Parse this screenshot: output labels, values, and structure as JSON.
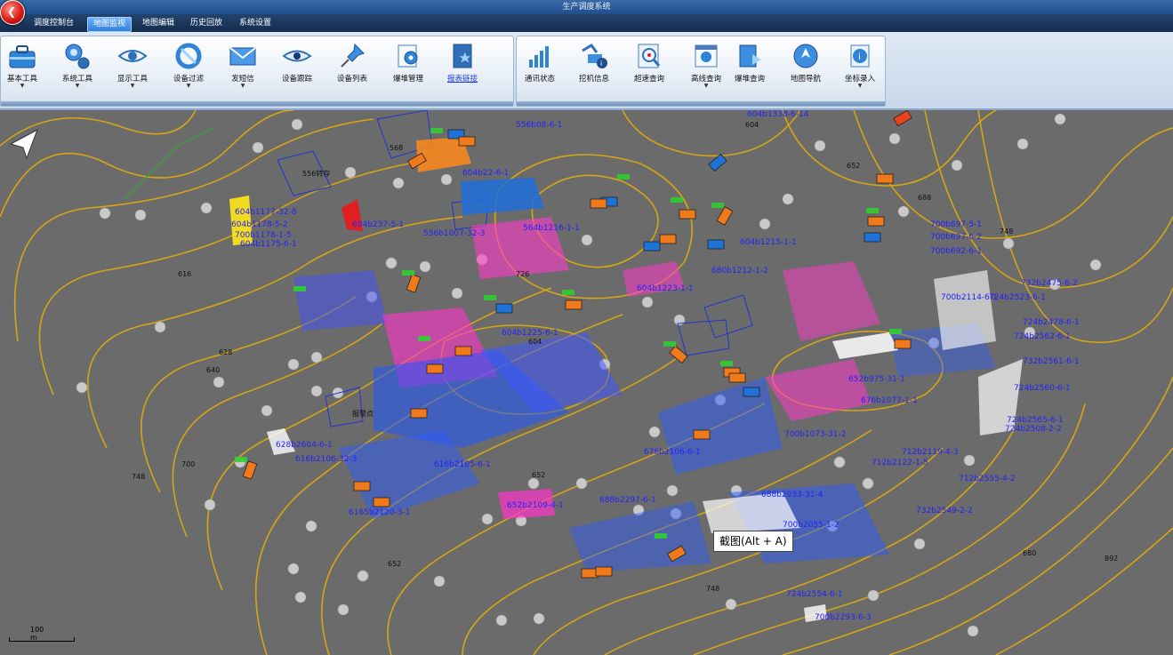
{
  "window": {
    "title": "生产调度系统"
  },
  "menu": {
    "tabs": [
      {
        "label": "调度控制台"
      },
      {
        "label": "地图监视"
      },
      {
        "label": "地图编辑"
      },
      {
        "label": "历史回放"
      },
      {
        "label": "系统设置"
      }
    ],
    "active_index": 1
  },
  "toolbar": {
    "left_group": [
      {
        "label": "基本工具",
        "icon": "toolbox-icon",
        "dropdown": true
      },
      {
        "label": "系统工具",
        "icon": "system-tools-icon",
        "dropdown": true
      },
      {
        "label": "显示工具",
        "icon": "eye-icon",
        "dropdown": true
      },
      {
        "label": "设备过滤",
        "icon": "filter-icon",
        "dropdown": true
      },
      {
        "label": "发短信",
        "icon": "envelope-icon",
        "dropdown": true
      },
      {
        "label": "设备跟踪",
        "icon": "eye-tracking-icon",
        "dropdown": false
      },
      {
        "label": "设备列表",
        "icon": "pushpin-icon",
        "dropdown": false
      },
      {
        "label": "爆堆管理",
        "icon": "settings-sheet-icon",
        "dropdown": false
      },
      {
        "label": "报表链接",
        "icon": "report-link-icon",
        "dropdown": false
      }
    ],
    "right_group": [
      {
        "label": "通讯状态",
        "icon": "signal-bars-icon",
        "dropdown": false
      },
      {
        "label": "挖机信息",
        "icon": "excavator-info-icon",
        "dropdown": false
      },
      {
        "label": "超速查询",
        "icon": "speed-search-icon",
        "dropdown": false
      },
      {
        "label": "高线查询",
        "icon": "route-search-icon",
        "dropdown": true
      },
      {
        "label": "爆堆查询",
        "icon": "blast-query-icon",
        "dropdown": false
      },
      {
        "label": "地图导航",
        "icon": "navigation-icon",
        "dropdown": false
      },
      {
        "label": "坐标录入",
        "icon": "coordinate-info-icon",
        "dropdown": true
      }
    ]
  },
  "map": {
    "labels": [
      "556b08-6-1",
      "604b1338-6-14",
      "604b22-6-1",
      "604b1177-32-8",
      "604b1178-5-2",
      "700b1178-1-5",
      "604b1175-6-1",
      "604b237-5-1",
      "556b1007-32-3",
      "604b1215-1-1",
      "604b1223-1-1",
      "700b697-5-1",
      "700b697-6-2",
      "700b692-6-1",
      "732b2475-6-2",
      "700b2114-6-1",
      "724b2523-6-1",
      "724b2478-6-1",
      "724b2562-6-1",
      "724b2560-6-1",
      "724b2565-6-1",
      "724b2508-2-2",
      "732b2561-6-1",
      "652b975-31-1",
      "676b1077-1-1",
      "700b1073-31-2",
      "712b2119-4-3",
      "712b2122-1-5",
      "724b2554-6-1",
      "700b2293-6-3",
      "688b2297-6-1",
      "712b2555-4-2",
      "628b2604-6-1",
      "616b2106-32-3",
      "616b2105-6-1",
      "6165b2120-3-1",
      "652b2109-4-1",
      "680b1212-1-2",
      "564b1216-1-1",
      "604b1225-6-1",
      "676b2106-6-1",
      "688b2033-31-4",
      "700b2055-1-2",
      "732b2549-2-2",
      "568",
      "604",
      "652",
      "726",
      "556转存",
      "报警点"
    ],
    "elevations": [
      "616",
      "628",
      "640",
      "700",
      "748",
      "652",
      "748",
      "680",
      "892",
      "604",
      "688",
      "748",
      "652"
    ],
    "scale_label": "100 m"
  },
  "tooltip": {
    "text": "截图(Alt + A)"
  },
  "colors": {
    "map_bg": "#6b6b6b",
    "contour": "#d4a514",
    "vehicle_orange": "#f07a1a",
    "vehicle_blue": "#1e73d8",
    "label_blue": "#2222ff",
    "highlight_magenta": "#ff33cc"
  }
}
